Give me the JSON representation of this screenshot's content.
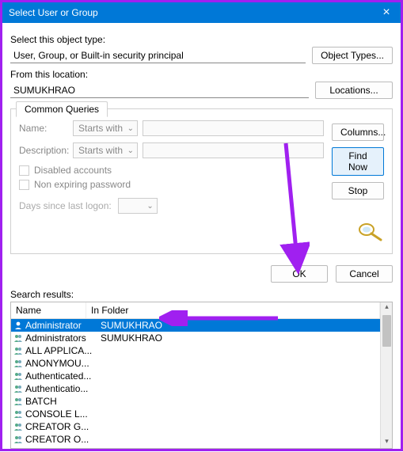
{
  "window": {
    "title": "Select User or Group"
  },
  "object_type": {
    "label": "Select this object type:",
    "value": "User, Group, or Built-in security principal",
    "button": "Object Types..."
  },
  "location": {
    "label": "From this location:",
    "value": "SUMUKHRAO",
    "button": "Locations..."
  },
  "queries": {
    "tab": "Common Queries",
    "name_label": "Name:",
    "name_mode": "Starts with",
    "desc_label": "Description:",
    "desc_mode": "Starts with",
    "disabled": "Disabled accounts",
    "nonexp": "Non expiring password",
    "days_label": "Days since last logon:",
    "columns_btn": "Columns...",
    "find_btn": "Find Now",
    "stop_btn": "Stop"
  },
  "actions": {
    "ok": "OK",
    "cancel": "Cancel"
  },
  "results": {
    "label": "Search results:",
    "col_name": "Name",
    "col_folder": "In Folder",
    "rows": [
      {
        "name": "Administrator",
        "folder": "SUMUKHRAO",
        "type": "user",
        "selected": true
      },
      {
        "name": "Administrators",
        "folder": "SUMUKHRAO",
        "type": "group",
        "selected": false
      },
      {
        "name": "ALL APPLICA...",
        "folder": "",
        "type": "group",
        "selected": false
      },
      {
        "name": "ANONYMOU...",
        "folder": "",
        "type": "group",
        "selected": false
      },
      {
        "name": "Authenticated...",
        "folder": "",
        "type": "group",
        "selected": false
      },
      {
        "name": "Authenticatio...",
        "folder": "",
        "type": "group",
        "selected": false
      },
      {
        "name": "BATCH",
        "folder": "",
        "type": "group",
        "selected": false
      },
      {
        "name": "CONSOLE L...",
        "folder": "",
        "type": "group",
        "selected": false
      },
      {
        "name": "CREATOR G...",
        "folder": "",
        "type": "group",
        "selected": false
      },
      {
        "name": "CREATOR O...",
        "folder": "",
        "type": "group",
        "selected": false
      }
    ]
  }
}
